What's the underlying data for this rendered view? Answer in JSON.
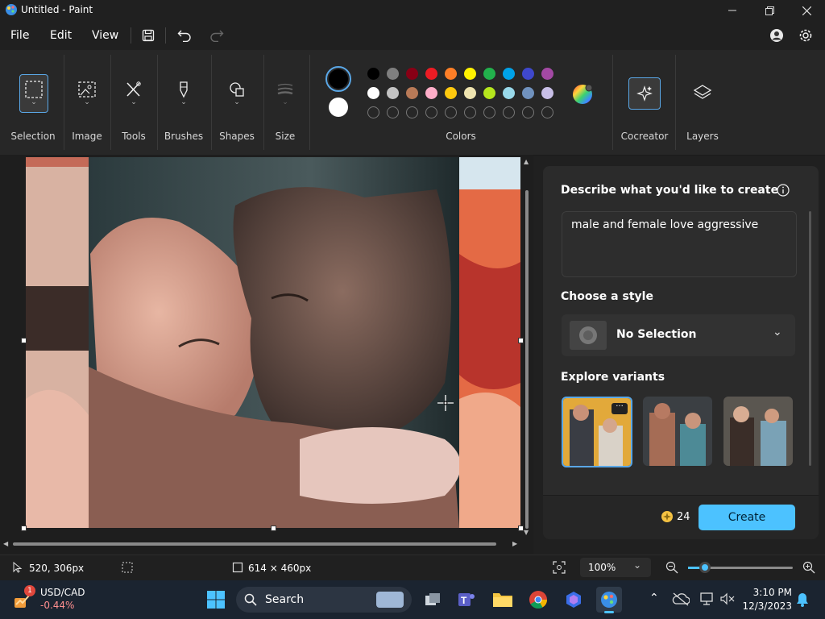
{
  "window": {
    "title": "Untitled - Paint",
    "app_icon": "paint-icon"
  },
  "menu": {
    "file": "File",
    "edit": "Edit",
    "view": "View"
  },
  "ribbon": {
    "groups": [
      {
        "label": "Selection",
        "icon": "selection-icon"
      },
      {
        "label": "Image",
        "icon": "image-icon"
      },
      {
        "label": "Tools",
        "icon": "tools-icon"
      },
      {
        "label": "Brushes",
        "icon": "brush-icon"
      },
      {
        "label": "Shapes",
        "icon": "shapes-icon"
      },
      {
        "label": "Size",
        "icon": "size-icon"
      },
      {
        "label": "Colors",
        "icon": "palette-icon"
      },
      {
        "label": "Cocreator",
        "icon": "cocreator-icon"
      },
      {
        "label": "Layers",
        "icon": "layers-icon"
      }
    ],
    "primary_color": "#000000",
    "secondary_color": "#ffffff",
    "palette_row1": [
      "#000000",
      "#7f7f7f",
      "#880015",
      "#ed1c24",
      "#ff7f27",
      "#fff200",
      "#22b14c",
      "#00a2e8",
      "#3f48cc",
      "#a349a4"
    ],
    "palette_row2": [
      "#ffffff",
      "#c3c3c3",
      "#b97a57",
      "#ffaec9",
      "#ffc90e",
      "#efe4b0",
      "#b5e61d",
      "#99d9ea",
      "#7092be",
      "#c8bfe7"
    ]
  },
  "cocreator": {
    "prompt_heading": "Describe what you'd like to create",
    "prompt_value": "male and female love aggressive",
    "style_heading": "Choose a style",
    "style_value": "No Selection",
    "variants_heading": "Explore variants",
    "credits": "24",
    "create_label": "Create"
  },
  "status": {
    "cursor_position": "520, 306px",
    "canvas_size": "614 × 460px",
    "zoom": "100%"
  },
  "taskbar": {
    "ticker_symbol": "USD/CAD",
    "ticker_change": "-0.44%",
    "ticker_badge": "1",
    "search_label": "Search",
    "time": "3:10 PM",
    "date": "12/3/2023"
  }
}
